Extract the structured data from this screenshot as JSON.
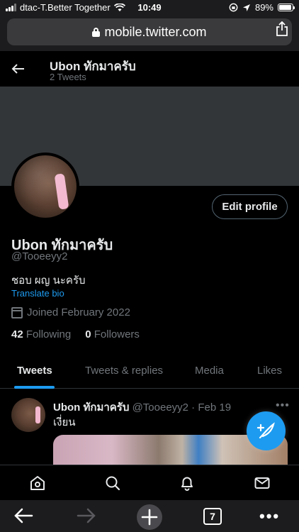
{
  "status_bar": {
    "carrier": "dtac-T.Better Together",
    "time": "10:49",
    "battery": "89%"
  },
  "browser": {
    "url": "mobile.twitter.com",
    "tab_count": "7"
  },
  "header": {
    "name": "Ubon ทักมาครับ",
    "tweet_count": "2 Tweets"
  },
  "profile": {
    "name": "Ubon ทักมาครับ",
    "handle": "@Tooeeyy2",
    "bio": "ชอบ ผญ นะครับ",
    "translate": "Translate bio",
    "joined": "Joined February 2022",
    "following_count": "42",
    "following_label": "Following",
    "followers_count": "0",
    "followers_label": "Followers",
    "edit_label": "Edit profile"
  },
  "tabs": [
    {
      "label": "Tweets",
      "active": true
    },
    {
      "label": "Tweets & replies",
      "active": false
    },
    {
      "label": "Media",
      "active": false
    },
    {
      "label": "Likes",
      "active": false
    }
  ],
  "tweet": {
    "name": "Ubon ทักมาครับ",
    "meta": "@Tooeeyy2 · Feb 19",
    "text": "เงี่ยน"
  },
  "colors": {
    "accent": "#1d9bf0",
    "background": "#000000",
    "banner": "#333639",
    "muted": "#71767b"
  },
  "icons": {
    "nav": [
      "home-icon",
      "search-icon",
      "bell-icon",
      "mail-icon"
    ],
    "compose": "feather-plus-icon"
  }
}
